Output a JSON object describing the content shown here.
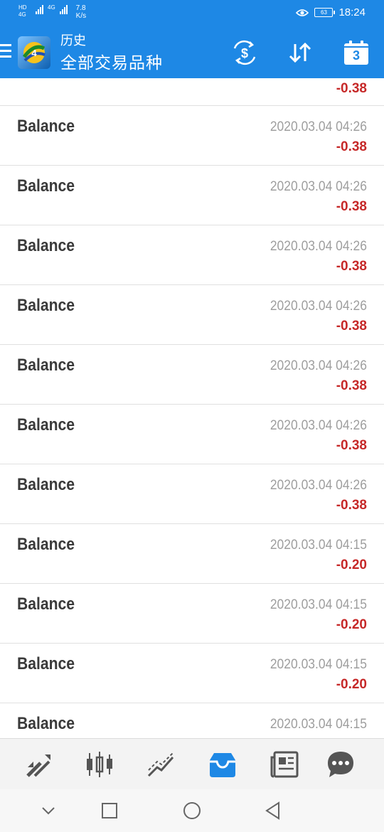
{
  "status_bar": {
    "network_left": "HD 4G",
    "network_right": "4G",
    "speed_value": "7.8",
    "speed_unit": "K/s",
    "battery": "63",
    "time": "18:24"
  },
  "app_bar": {
    "title": "历史",
    "subtitle": "全部交易品种",
    "calendar_day": "3"
  },
  "history": {
    "partial_top_amount": "-0.38",
    "rows": [
      {
        "title": "Balance",
        "date": "2020.03.04 04:26",
        "amount": "-0.38"
      },
      {
        "title": "Balance",
        "date": "2020.03.04 04:26",
        "amount": "-0.38"
      },
      {
        "title": "Balance",
        "date": "2020.03.04 04:26",
        "amount": "-0.38"
      },
      {
        "title": "Balance",
        "date": "2020.03.04 04:26",
        "amount": "-0.38"
      },
      {
        "title": "Balance",
        "date": "2020.03.04 04:26",
        "amount": "-0.38"
      },
      {
        "title": "Balance",
        "date": "2020.03.04 04:26",
        "amount": "-0.38"
      },
      {
        "title": "Balance",
        "date": "2020.03.04 04:26",
        "amount": "-0.38"
      },
      {
        "title": "Balance",
        "date": "2020.03.04 04:15",
        "amount": "-0.20"
      },
      {
        "title": "Balance",
        "date": "2020.03.04 04:15",
        "amount": "-0.20"
      },
      {
        "title": "Balance",
        "date": "2020.03.04 04:15",
        "amount": "-0.20"
      },
      {
        "title": "Balance",
        "date": "2020.03.04 04:15",
        "amount": ""
      }
    ]
  },
  "bottom_nav": {
    "items": [
      "quotes-icon",
      "chart-icon",
      "trade-icon",
      "history-icon",
      "news-icon",
      "chat-icon"
    ],
    "active": "history-icon"
  },
  "colors": {
    "primary": "#1e88e5",
    "negative": "#c62828",
    "active_tab": "#1e88e5",
    "inactive_tab": "#555555"
  }
}
